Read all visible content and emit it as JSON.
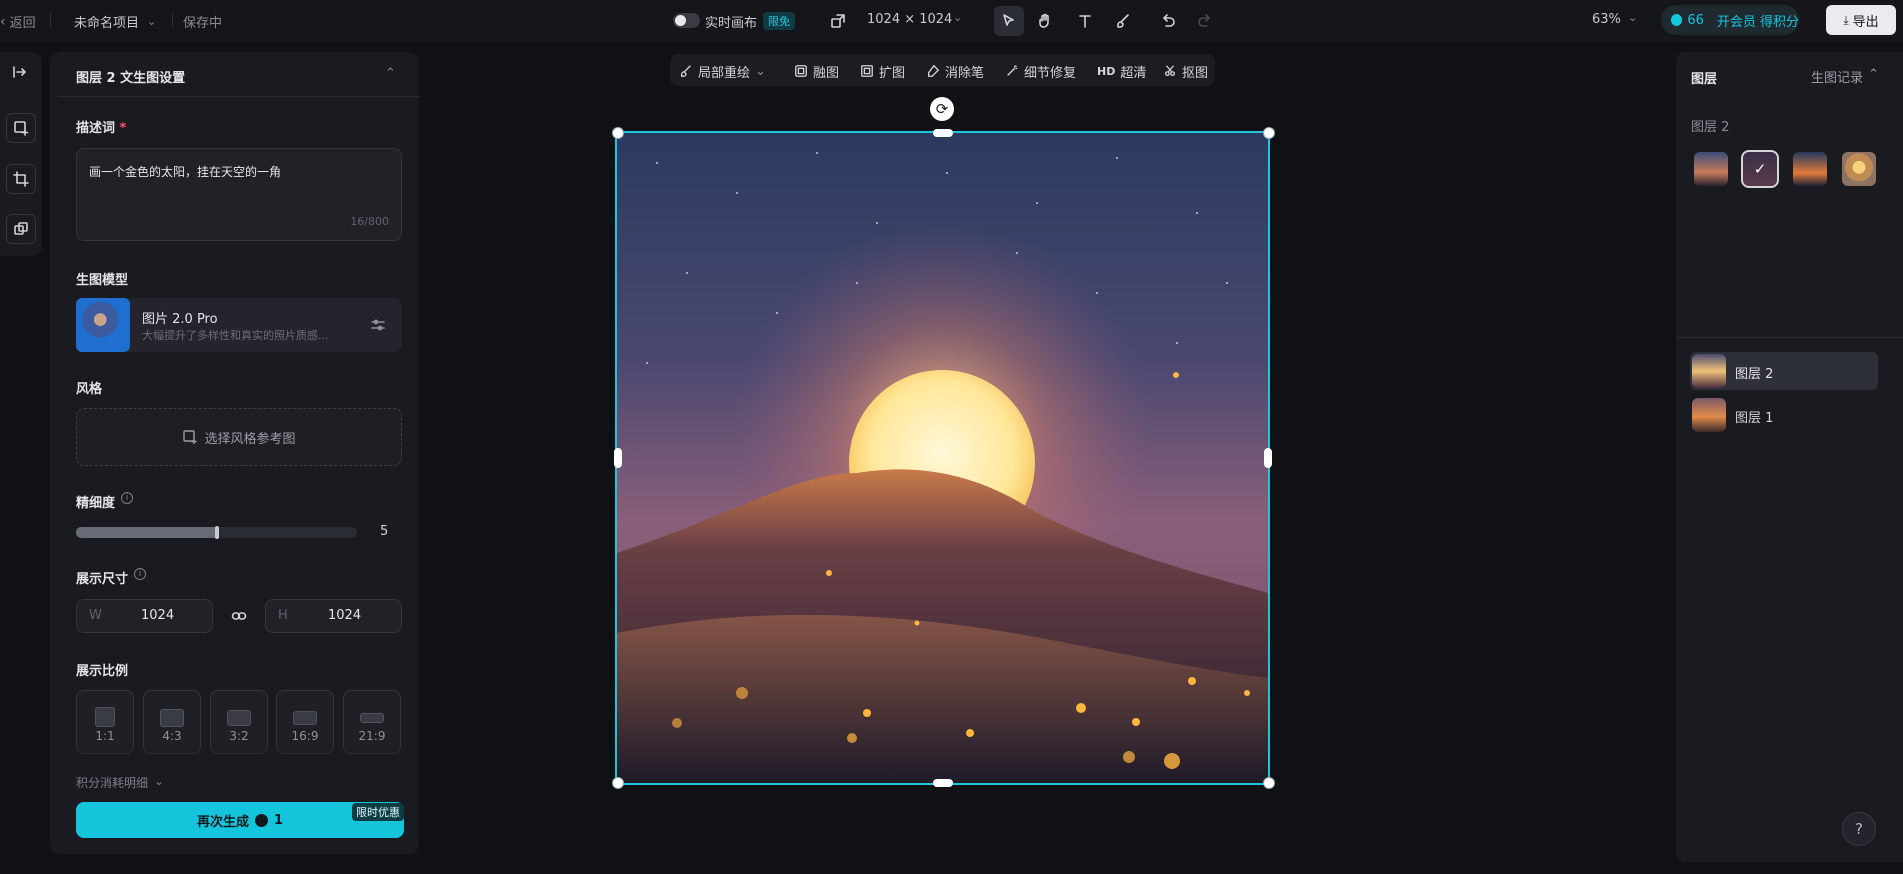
{
  "topbar": {
    "back_label": "返回",
    "project_name": "未命名项目",
    "save_status": "保存中",
    "realtime_label": "实时画布",
    "realtime_badge": "限免",
    "canvas_size": "1024 × 1024",
    "zoom": "63%",
    "credits": "66",
    "member_label": "开会员 得积分",
    "export_label": "导出"
  },
  "settings_panel": {
    "title": "图层 2 文生图设置",
    "prompt_label": "描述词",
    "required_mark": "*",
    "prompt_value": "画一个金色的太阳，挂在天空的一角",
    "prompt_count": "16/800",
    "model_label": "生图模型",
    "model_name": "图片 2.0 Pro",
    "model_desc": "大幅提升了多样性和真实的照片质感...",
    "style_label": "风格",
    "style_button": "选择风格参考图",
    "detail_label": "精细度",
    "detail_value": "5",
    "detail_fraction": 0.5,
    "size_label": "展示尺寸",
    "width_prefix": "W",
    "width_value": "1024",
    "height_prefix": "H",
    "height_value": "1024",
    "ratio_label": "展示比例",
    "ratios": [
      "1:1",
      "4:3",
      "3:2",
      "16:9",
      "21:9"
    ],
    "cost_detail": "积分消耗明细",
    "generate_label": "再次生成",
    "generate_cost": "1",
    "promo_badge": "限时优惠"
  },
  "canvas_toolbar": {
    "tools": [
      "局部重绘",
      "融图",
      "扩图",
      "消除笔",
      "细节修复",
      "超清",
      "抠图"
    ],
    "hd_badge": "HD"
  },
  "layers_panel": {
    "title": "图层",
    "history_label": "生图记录",
    "group_label": "图层 2",
    "layers": [
      "图层 2",
      "图层 1"
    ]
  },
  "help_label": "?",
  "colors": {
    "accent": "#15c5dc",
    "selection": "#1ec8dc",
    "background": "#101114",
    "panel": "#1a1b20"
  }
}
